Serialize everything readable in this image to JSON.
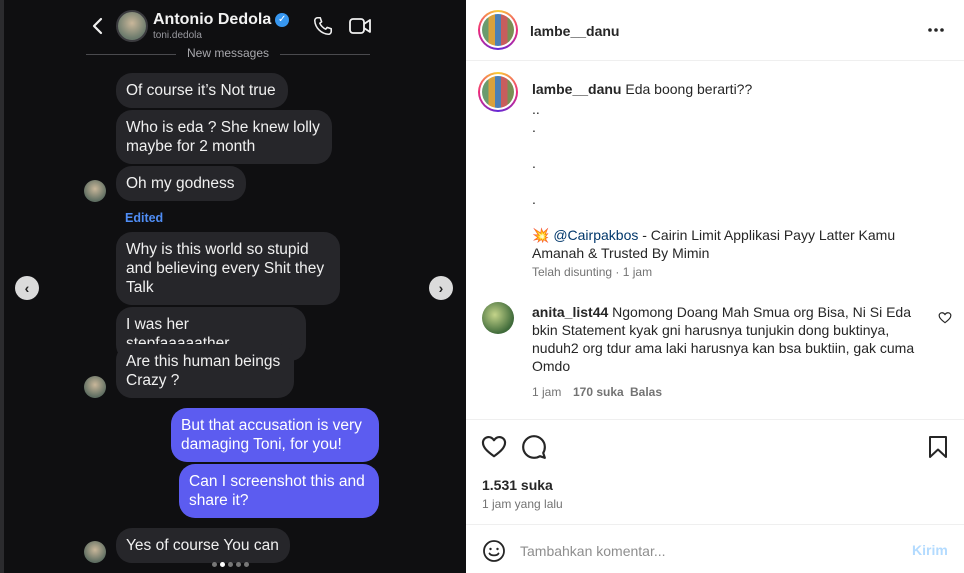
{
  "chat": {
    "contact_name": "Antonio Dedola",
    "contact_username": "toni.dedola",
    "verified_icon": "verified-badge-icon",
    "divider_label": "New messages",
    "edited_label": "Edited",
    "messages": [
      {
        "text": "Of course it’s Not true",
        "direction": "in"
      },
      {
        "text": "Who is eda ? She knew lolly maybe for 2 month",
        "direction": "in"
      },
      {
        "text": "Oh my godness",
        "direction": "in"
      },
      {
        "text": "Why is this world so stupid and believing every Shit they Talk",
        "direction": "in"
      },
      {
        "text": "I was her stepfaaaaather",
        "direction": "in"
      },
      {
        "text": "Are this human beings Crazy ?",
        "direction": "in"
      },
      {
        "text": "But that accusation is very damaging Toni, for you!",
        "direction": "out"
      },
      {
        "text": "Can I screenshot this and share it?",
        "direction": "out"
      },
      {
        "text": "Yes of course You can",
        "direction": "in"
      }
    ],
    "carousel": {
      "count": 5,
      "active_index": 1
    }
  },
  "post": {
    "author": "lambe__danu",
    "caption": {
      "author": "lambe__danu",
      "text": "Eda boong berarti??",
      "dot_lines": [
        "..",
        ".",
        ".",
        "."
      ],
      "promo_emoji": "💥",
      "mention": "@Cairpakbos",
      "promo_text": " - Cairin Limit Applikasi Payy Latter Kamu Amanah & Trusted By Mimin",
      "meta": "Telah disunting · 1 jam"
    },
    "comment": {
      "author": "anita_list44",
      "text": "Ngomong Doang Mah Smua org Bisa, Ni Si Eda bkin Statement kyak gni harusnya tunjukin dong buktinya, nuduh2 org tdur ama laki harusnya kan bsa buktiin, gak cuma Omdo",
      "time": "1 jam",
      "likes": "170 suka",
      "reply_label": "Balas"
    },
    "likes_count": "1.531 suka",
    "posted_ago": "1 jam yang lalu",
    "comment_placeholder": "Tambahkan komentar...",
    "post_button": "Kirim"
  }
}
